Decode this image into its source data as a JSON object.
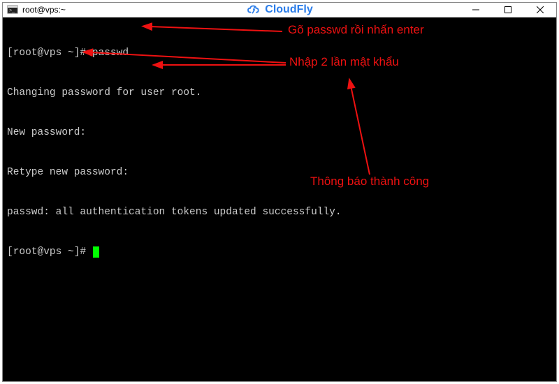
{
  "window": {
    "title": "root@vps:~"
  },
  "brand": {
    "name": "CloudFly"
  },
  "terminal": {
    "lines": [
      "[root@vps ~]# passwd",
      "Changing password for user root.",
      "New password:",
      "Retype new password:",
      "passwd: all authentication tokens updated successfully.",
      "[root@vps ~]# "
    ]
  },
  "annotations": {
    "a1": "Gõ passwd rồi nhấn enter",
    "a2": "Nhập 2 lần mật khẩu",
    "a3": "Thông báo thành công"
  },
  "colors": {
    "annotation": "#e11",
    "cursor": "#00ff00",
    "brand": "#2b7de9"
  }
}
